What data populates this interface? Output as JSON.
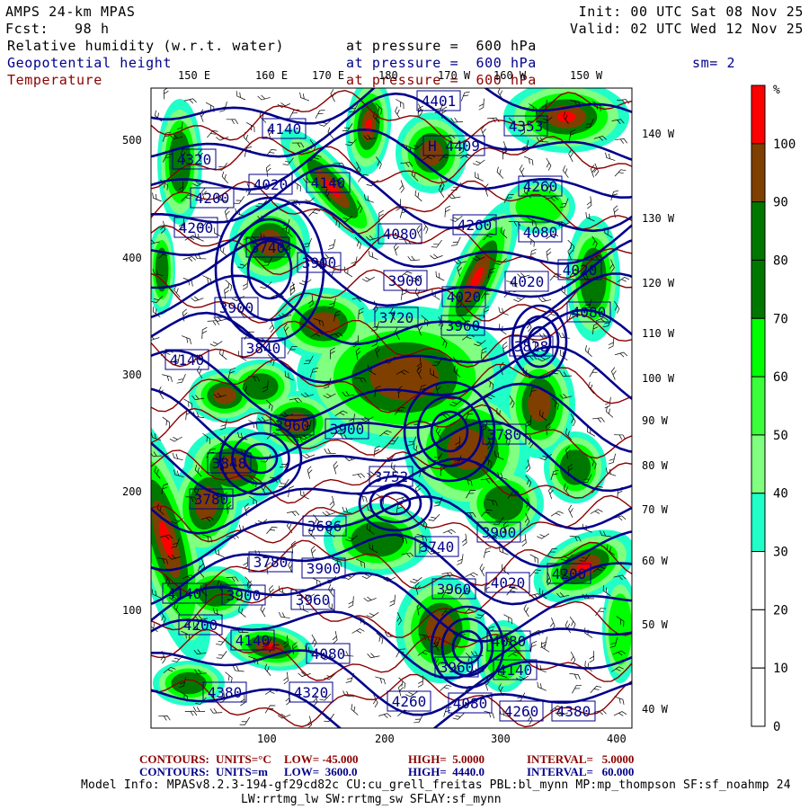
{
  "header": {
    "model": "AMPS 24-km MPAS",
    "fcst": "Fcst:   98 h",
    "init": "Init: 00 UTC Sat 08 Nov 25",
    "valid": "Valid: 02 UTC Wed 12 Nov 25",
    "fields": [
      {
        "name": "Relative humidity (w.r.t. water)",
        "level": "at pressure =  600 hPa"
      },
      {
        "name": "Geopotential height",
        "level": "at pressure =  600 hPa"
      },
      {
        "name": "Temperature",
        "level": "at pressure =  600 hPa"
      }
    ],
    "smoothing": "sm= 2"
  },
  "axes": {
    "left_ticks": [
      "500",
      "400",
      "300",
      "200",
      "100"
    ],
    "bottom_ticks": [
      "100",
      "200",
      "300",
      "400"
    ],
    "top_lon": [
      "150 E",
      "160 E",
      "170 E",
      "180",
      "170 W",
      "160 W",
      "150 W"
    ],
    "right_lon": [
      "140 W",
      "130 W",
      "120 W",
      "110 W",
      "100 W",
      "90 W",
      "80 W",
      "70 W",
      "60 W",
      "50 W",
      "40 W"
    ]
  },
  "colorbar": {
    "unit": "%",
    "labels": [
      "100",
      "90",
      "80",
      "70",
      "60",
      "50",
      "40",
      "30",
      "20",
      "10",
      "0"
    ],
    "colors": [
      "#ff0000",
      "#7f3f00",
      "#007800",
      "#007800",
      "#00ff00",
      "#3cff3c",
      "#80ff80",
      "#20ffc8",
      "#ffffff",
      "#ffffff",
      "#ffffff",
      "#ffffff"
    ]
  },
  "map": {
    "height_labels": [
      "4401",
      "4140",
      "4353",
      "4320",
      "H 4409",
      "4200",
      "4020",
      "4140",
      "4260",
      "4200",
      "4080",
      "4260",
      "4080",
      "3740",
      "3900",
      "4020",
      "4020",
      "3900",
      "4020",
      "4080",
      "3900",
      "3720",
      "3960",
      "3828",
      "3840",
      "4140",
      "3960",
      "3900",
      "3780",
      "3848",
      "3752",
      "3780",
      "3686",
      "3900",
      "3740",
      "3780",
      "3900",
      "4020",
      "4200",
      "3960",
      "4140",
      "3900",
      "3960",
      "4200",
      "4140",
      "4080",
      "4080",
      "4140",
      "3960",
      "4380",
      "4320",
      "4260",
      "4080",
      "4260",
      "4380"
    ],
    "colors": {
      "height": "#00008b",
      "temperature": "#8b0000",
      "brown": "#7f3f00",
      "darkgreen": "#007800",
      "green": "#00ff00",
      "lightgreen": "#80ff80",
      "cyan": "#20ffc8"
    }
  },
  "footer": {
    "temp_contours": {
      "label": "CONTOURS:",
      "units": "UNITS=°C",
      "low": "LOW= -45.000",
      "high": "HIGH=  5.0000",
      "interval": "INTERVAL=   5.0000"
    },
    "height_contours": {
      "label": "CONTOURS:",
      "units": "UNITS=m",
      "low": "LOW=  3600.0",
      "high": "HIGH=  4440.0",
      "interval": "INTERVAL=   60.000"
    },
    "model_info_1": "Model Info: MPASv8.2.3-194-gf29cd82c CU:cu_grell_freitas PBL:bl_mynn MP:mp_thompson SF:sf_noahmp 24",
    "model_info_2": "LW:rrtmg_lw SW:rrtmg_sw SFLAY:sf_mynn"
  }
}
